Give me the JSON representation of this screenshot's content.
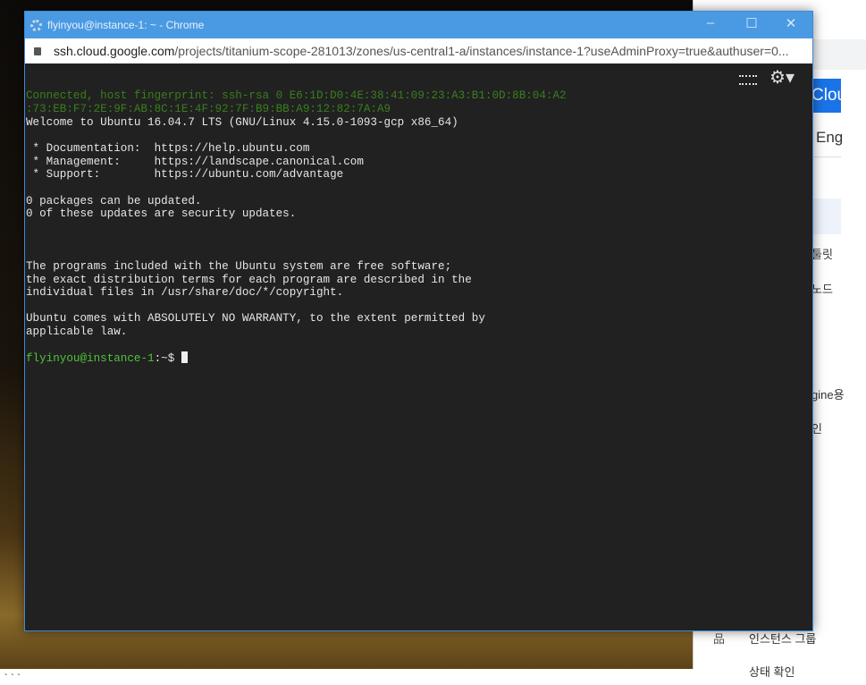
{
  "window": {
    "title": "flyinyou@instance-1: ~ - Chrome",
    "url_host": "ssh.cloud.google.com",
    "url_path": "/projects/titanium-scope-281013/zones/us-central1-a/instances/instance-1?useAdminProxy=true&authuser=0..."
  },
  "terminal": {
    "lines": [
      {
        "t": "Connected, host fingerprint: ssh-rsa 0 E6:1D:D0:4E:38:41:09:23:A3:B1:0D:8B:04:A2",
        "c": "g"
      },
      {
        "t": ":73:EB:F7:2E:9F:AB:8C:1E:4F:92:7F:B9:BB:A9:12:82:7A:A9",
        "c": "g"
      },
      {
        "t": "Welcome to Ubuntu 16.04.7 LTS (GNU/Linux 4.15.0-1093-gcp x86_64)"
      },
      {
        "t": ""
      },
      {
        "t": " * Documentation:  https://help.ubuntu.com"
      },
      {
        "t": " * Management:     https://landscape.canonical.com"
      },
      {
        "t": " * Support:        https://ubuntu.com/advantage"
      },
      {
        "t": ""
      },
      {
        "t": "0 packages can be updated."
      },
      {
        "t": "0 of these updates are security updates."
      },
      {
        "t": ""
      },
      {
        "t": ""
      },
      {
        "t": ""
      },
      {
        "t": "The programs included with the Ubuntu system are free software;"
      },
      {
        "t": "the exact distribution terms for each program are described in the"
      },
      {
        "t": "individual files in /usr/share/doc/*/copyright."
      },
      {
        "t": ""
      },
      {
        "t": "Ubuntu comes with ABSOLUTELY NO WARRANTY, to the extent permitted by"
      },
      {
        "t": "applicable law."
      },
      {
        "t": ""
      }
    ],
    "prompt": "flyinyou@instance-1",
    "prompt_suffix": ":~$ "
  },
  "background": {
    "header": "Cloud",
    "eng": "Eng",
    "items": [
      "툴릿",
      "노드",
      "gine용",
      "인",
      "인스턴스 그룹",
      "상태 확인"
    ],
    "stray": "```"
  }
}
